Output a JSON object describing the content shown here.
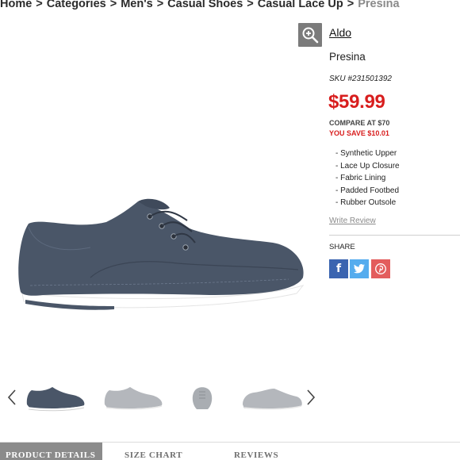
{
  "breadcrumb": {
    "items": [
      "Home",
      "Categories",
      "Men's",
      "Casual Shoes",
      "Casual Lace Up"
    ],
    "separator": ">",
    "current": "Presina"
  },
  "product": {
    "brand": "Aldo",
    "name": "Presina",
    "sku": "SKU #231501392",
    "price": "$59.99",
    "compare_at": "COMPARE AT $70",
    "you_save": "YOU SAVE $10.01",
    "features": [
      "- Synthetic Upper",
      "- Lace Up Closure",
      "- Fabric Lining",
      "- Padded Footbed",
      "- Rubber Outsole"
    ],
    "write_review": "Write Review"
  },
  "share": {
    "label": "SHARE",
    "buttons": [
      "facebook-icon",
      "twitter-icon",
      "pinterest-icon"
    ]
  },
  "gallery": {
    "thumbnails": [
      "side view",
      "side view grey",
      "top view",
      "angled view"
    ]
  },
  "tabs": [
    {
      "label": "PRODUCT DETAILS",
      "active": true
    },
    {
      "label": "SIZE CHART",
      "active": false
    },
    {
      "label": "REVIEWS",
      "active": false
    }
  ],
  "colors": {
    "price_red": "#d81e1e",
    "shoe_navy": "#4a5668",
    "tab_active_bg": "#8b8b8b",
    "facebook": "#3a64b0",
    "twitter": "#55acee",
    "pinterest": "#e35d5d"
  }
}
